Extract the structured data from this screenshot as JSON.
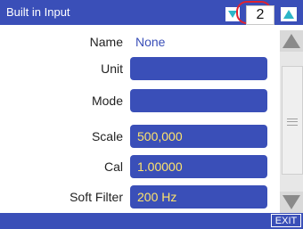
{
  "header": {
    "title": "Built in Input",
    "page_number": "2",
    "down_icon": "triangle-down-icon",
    "up_icon": "triangle-up-icon"
  },
  "form": {
    "name": {
      "label": "Name",
      "value": "None"
    },
    "unit": {
      "label": "Unit",
      "value": ""
    },
    "mode": {
      "label": "Mode",
      "value": ""
    },
    "scale": {
      "label": "Scale",
      "value": "500,000"
    },
    "cal": {
      "label": "Cal",
      "value": "1.00000"
    },
    "soft_filter": {
      "label": "Soft Filter",
      "value": "200 Hz"
    }
  },
  "footer": {
    "exit_label": "EXIT"
  },
  "colors": {
    "bar_blue": "#3a4fb8",
    "field_blue": "#3a4fb8",
    "value_yellow": "#ffe46b",
    "arrow_cyan": "#2cb6c8",
    "highlight_red": "#e0232f"
  }
}
